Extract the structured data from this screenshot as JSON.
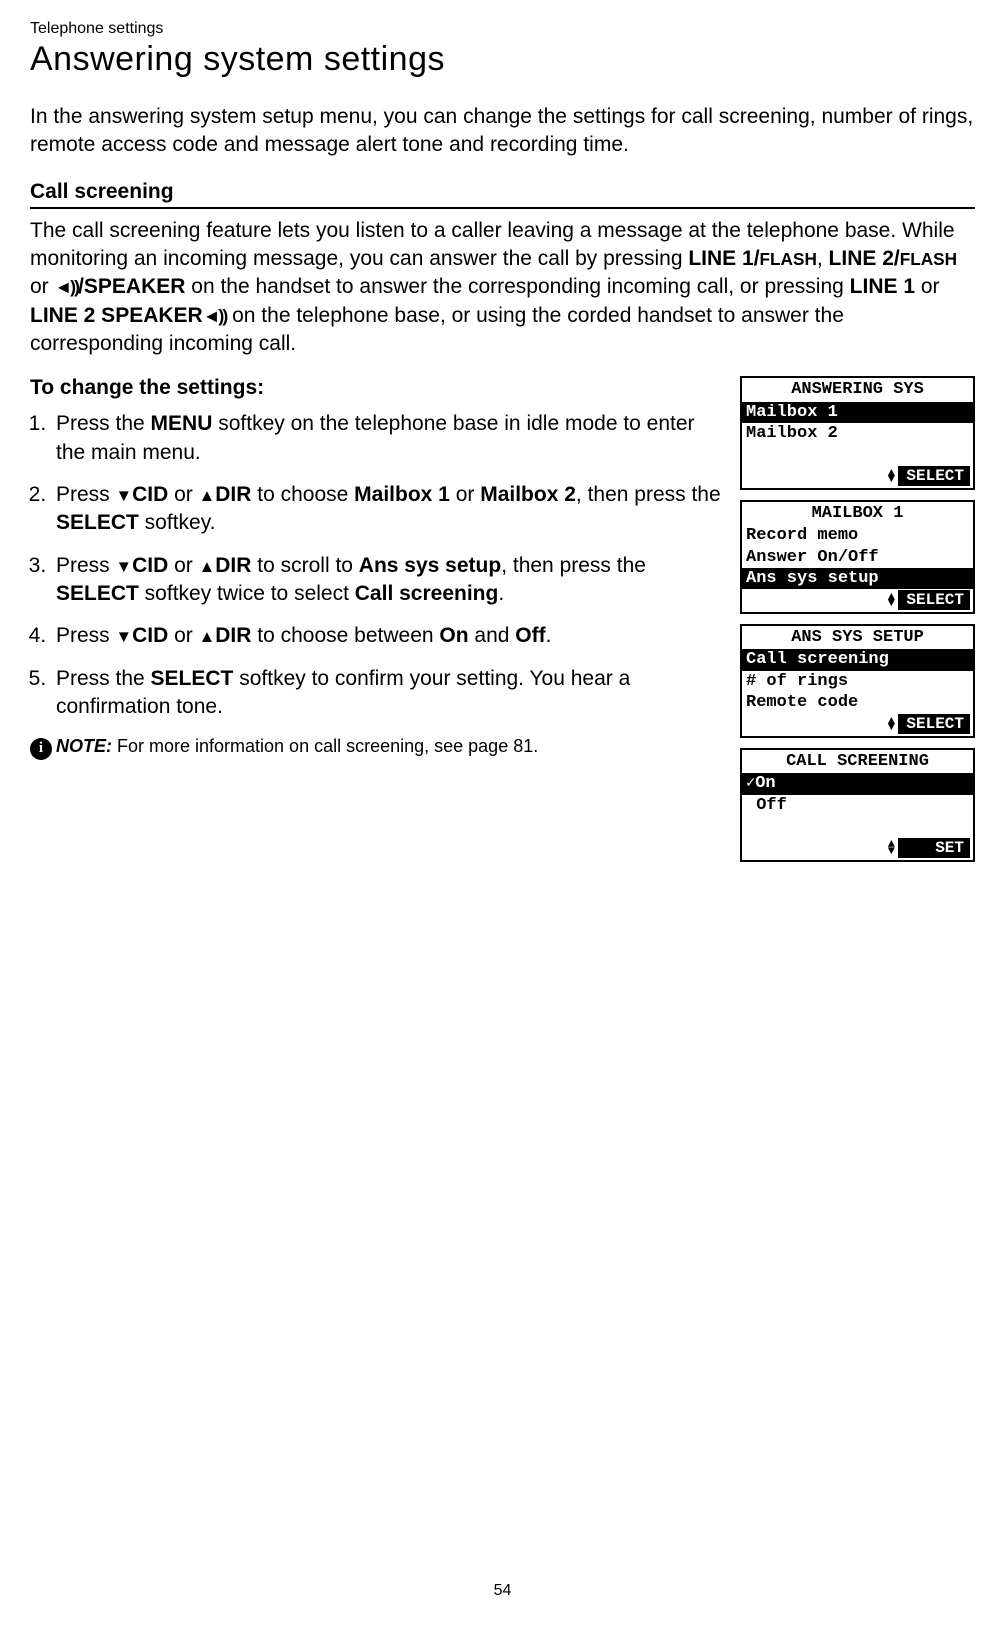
{
  "breadcrumb": "Telephone settings",
  "title": "Answering system settings",
  "intro": "In the answering system setup menu, you can change the settings for call screening, number of rings, remote access code and message alert tone and recording time.",
  "section": {
    "heading": "Call screening",
    "body_parts": {
      "p1": "The call screening feature lets you listen to a caller leaving a message at the telephone base. While monitoring an incoming message, you can answer the call by pressing ",
      "line1": "LINE 1/",
      "flash1": "FLASH",
      "comma1": ", ",
      "line2": "LINE 2/",
      "flash2": "FLASH",
      "or1": " or ",
      "speaker1": "/SPEAKER",
      "p2": " on the handset to answer the corresponding incoming call, or pressing ",
      "line1b": "LINE 1",
      "or2": " or ",
      "line2b": "LINE 2 SPEAKER",
      "p3": " on the telephone base, or using the corded handset to answer the corresponding incoming call."
    }
  },
  "steps_heading": "To change the settings:",
  "steps": {
    "s1a": "Press the ",
    "s1menu": "MENU",
    "s1b": " softkey on the telephone base in idle mode to enter the main menu.",
    "s2a": "Press ",
    "s2cid": "CID",
    "s2or": " or ",
    "s2dir": "DIR",
    "s2b": " to choose ",
    "s2mb1": "Mailbox 1",
    "s2or2": " or ",
    "s2mb2": "Mailbox 2",
    "s2c": ", then press the ",
    "s2sel": "SELECT",
    "s2d": " softkey.",
    "s3a": "Press ",
    "s3cid": "CID",
    "s3or": " or ",
    "s3dir": "DIR",
    "s3b": " to scroll to ",
    "s3ans": "Ans sys setup",
    "s3c": ", then press the ",
    "s3sel": "SELECT",
    "s3d": " softkey twice to select ",
    "s3cs": "Call screening",
    "s3e": ".",
    "s4a": "Press ",
    "s4cid": "CID",
    "s4or": " or ",
    "s4dir": "DIR",
    "s4b": " to choose between ",
    "s4on": "On",
    "s4and": " and ",
    "s4off": "Off",
    "s4c": ".",
    "s5a": "Press the ",
    "s5sel": "SELECT",
    "s5b": " softkey to confirm your setting. You hear a confirmation tone."
  },
  "note": {
    "label": "NOTE:",
    "text": " For more information on call screening, see page 81."
  },
  "screens": {
    "s1": {
      "title": "ANSWERING SYS",
      "line1": "Mailbox 1",
      "line2": "Mailbox 2",
      "soft": "SELECT"
    },
    "s2": {
      "title": "MAILBOX 1",
      "line1": "Record memo",
      "line2": "Answer On/Off",
      "line3": "Ans sys setup",
      "soft": "SELECT"
    },
    "s3": {
      "title": "ANS SYS SETUP",
      "line1": "Call screening",
      "line2": "# of rings",
      "line3": "Remote code",
      "soft": "SELECT"
    },
    "s4": {
      "title": "CALL SCREENING",
      "line1": "On",
      "line2": " Off",
      "soft": " SET "
    }
  },
  "pagenum": "54"
}
